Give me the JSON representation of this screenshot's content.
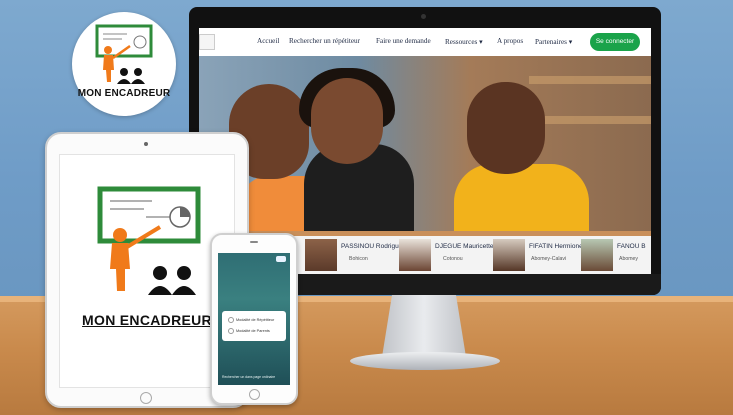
{
  "brand": {
    "name": "MON ENCADREUR",
    "colors": {
      "accent": "#1aa34a",
      "figure": "#f07a1a",
      "board": "#2e8b3a"
    }
  },
  "monitor_site": {
    "nav": {
      "items": [
        "Accueil",
        "Rechercher un répétiteur",
        "Faire une demande",
        "Ressources",
        "A propos",
        "Partenaires"
      ],
      "login_button": "Se connecter"
    },
    "tutors": [
      {
        "name": "PASSINOU Rodrigue",
        "city": "Bohicon"
      },
      {
        "name": "DJEGUE Mauricette",
        "city": "Cotonou"
      },
      {
        "name": "FIFATIN Hermione",
        "city": "Abomey-Calavi"
      },
      {
        "name": "FANOU B",
        "city": "Abomey"
      }
    ],
    "left_fragment": "es"
  },
  "phone_app": {
    "options": [
      "Modalité de Répétiteur",
      "Modalité de Parents"
    ],
    "footer": "Rechercher un dans page ordinaire"
  },
  "icons": [
    "teacher-pointing-icon",
    "whiteboard-icon",
    "students-icon",
    "chevron-down-icon"
  ]
}
